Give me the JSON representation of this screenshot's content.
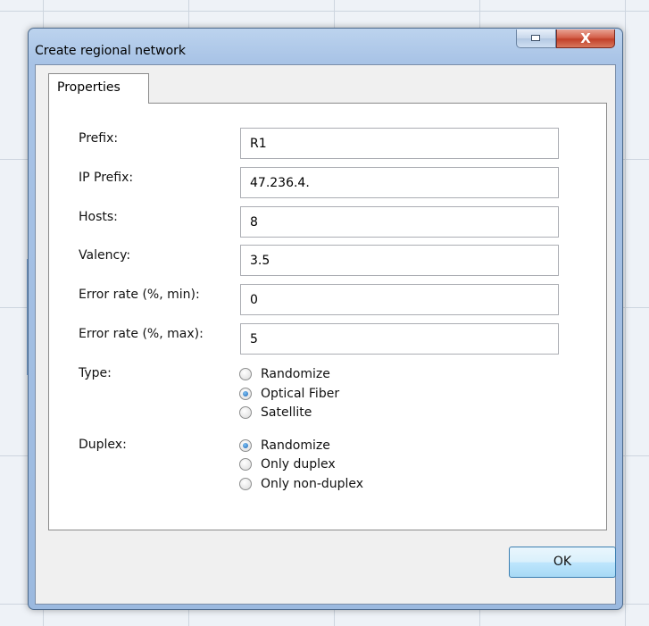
{
  "window": {
    "title": "Create regional network",
    "close_glyph": "X"
  },
  "tabs": [
    {
      "label": "Properties"
    }
  ],
  "fields": {
    "prefix": {
      "label": "Prefix:",
      "value": "R1"
    },
    "ip_prefix": {
      "label": "IP Prefix:",
      "value": "47.236.4."
    },
    "hosts": {
      "label": "Hosts:",
      "value": "8"
    },
    "valency": {
      "label": "Valency:",
      "value": "3.5"
    },
    "error_rate_min": {
      "label": "Error rate (%, min):",
      "value": "0"
    },
    "error_rate_max": {
      "label": "Error rate (%, max):",
      "value": "5"
    }
  },
  "type": {
    "label": "Type:",
    "options": [
      "Randomize",
      "Optical Fiber",
      "Satellite"
    ],
    "selected": "Optical Fiber"
  },
  "duplex": {
    "label": "Duplex:",
    "options": [
      "Randomize",
      "Only duplex",
      "Only non-duplex"
    ],
    "selected": "Randomize"
  },
  "buttons": {
    "ok": "OK"
  },
  "icons": {
    "minimize": "minimize-icon",
    "close": "close-icon"
  },
  "colors": {
    "title_bar": "#a8c3e6",
    "close_button": "#c2412a",
    "ok_button": "#bee6fd",
    "radio_selected": "#1b64b4"
  }
}
